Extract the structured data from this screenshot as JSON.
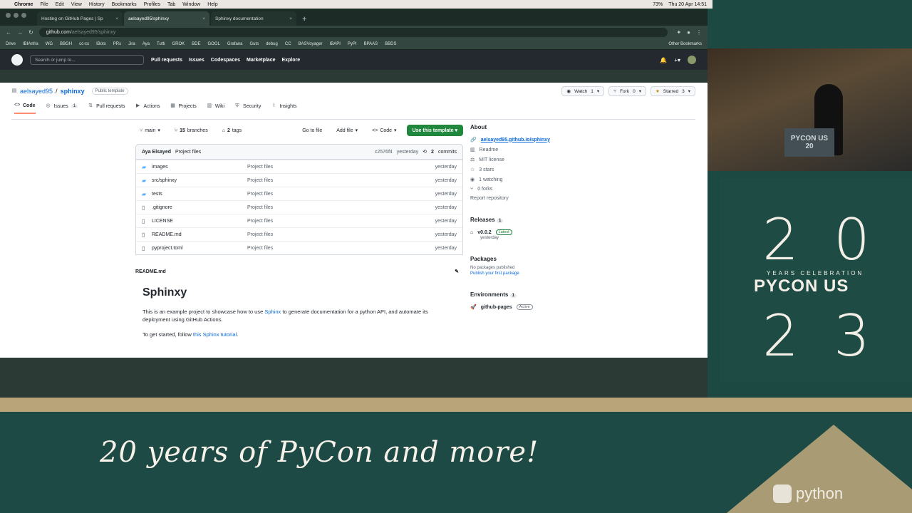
{
  "mac": {
    "app": "Chrome",
    "menus": [
      "File",
      "Edit",
      "View",
      "History",
      "Bookmarks",
      "Profiles",
      "Tab",
      "Window",
      "Help"
    ],
    "battery": "73%",
    "datetime": "Thu 20 Apr  14:51"
  },
  "browser": {
    "tabs": [
      {
        "title": "Hosting on GitHub Pages | Sp"
      },
      {
        "title": "aelsayed95/sphinxy"
      },
      {
        "title": "Sphinxy documentation"
      }
    ],
    "url": "github.com",
    "url_rest": "/aelsayed95/sphinxy",
    "bookmarks": [
      "Drive",
      "IBIAnfra",
      "WG",
      "BBGH",
      "cc-cs",
      "IBots",
      "PRs",
      "Jira",
      "Aya",
      "Tutti",
      "GROK",
      "BDE",
      "GOOL",
      "Grafana",
      "Guts",
      "debug",
      "CC",
      "BASVoyager",
      "IBAPI",
      "PyPI",
      "BPAAS",
      "BBDS"
    ],
    "other_bookmarks": "Other Bookmarks"
  },
  "github": {
    "search_placeholder": "Search or jump to...",
    "nav": [
      "Pull requests",
      "Issues",
      "Codespaces",
      "Marketplace",
      "Explore"
    ],
    "owner": "aelsayed95",
    "repo": "sphinxy",
    "visibility": "Public template",
    "watch": {
      "label": "Watch",
      "count": "1"
    },
    "fork": {
      "label": "Fork",
      "count": "0"
    },
    "star": {
      "label": "Starred",
      "count": "3"
    },
    "tabs": [
      {
        "label": "Code"
      },
      {
        "label": "Issues",
        "count": "1"
      },
      {
        "label": "Pull requests"
      },
      {
        "label": "Actions"
      },
      {
        "label": "Projects"
      },
      {
        "label": "Wiki"
      },
      {
        "label": "Security"
      },
      {
        "label": "Insights"
      }
    ],
    "branch": "main",
    "branches": "15",
    "branches_label": "branches",
    "tags": "2",
    "tags_label": "tags",
    "goto_file": "Go to file",
    "add_file": "Add file",
    "code_btn": "Code",
    "use_template": "Use this template",
    "commit": {
      "author": "Aya Elsayed",
      "message": "Project files",
      "hash": "c2576f4",
      "when": "yesterday",
      "commits": "2",
      "commits_label": "commits"
    },
    "files": [
      {
        "type": "dir",
        "name": "images",
        "msg": "Project files",
        "date": "yesterday"
      },
      {
        "type": "dir",
        "name": "src/sphinxy",
        "msg": "Project files",
        "date": "yesterday"
      },
      {
        "type": "dir",
        "name": "tests",
        "msg": "Project files",
        "date": "yesterday"
      },
      {
        "type": "file",
        "name": ".gitignore",
        "msg": "Project files",
        "date": "yesterday"
      },
      {
        "type": "file",
        "name": "LICENSE",
        "msg": "Project files",
        "date": "yesterday"
      },
      {
        "type": "file",
        "name": "README.md",
        "msg": "Project files",
        "date": "yesterday"
      },
      {
        "type": "file",
        "name": "pyproject.toml",
        "msg": "Project files",
        "date": "yesterday"
      }
    ],
    "readme": {
      "file": "README.md",
      "title": "Sphinxy",
      "p1_a": "This is an example project to showcase how to use",
      "p1_link": "Sphinx",
      "p1_b": "to generate documentation for a python API, and automate its deployment using GitHub Actions.",
      "p2_a": "To get started, follow",
      "p2_link": "this Sphinx tutorial",
      "p2_b": "."
    },
    "about": {
      "title": "About",
      "link": "aelsayed95.github.io/sphinxy",
      "readme": "Readme",
      "license": "MIT license",
      "stars": "3 stars",
      "watching": "1 watching",
      "forks": "0 forks",
      "report": "Report repository"
    },
    "releases": {
      "title": "Releases",
      "count": "1",
      "version": "v0.0.2",
      "badge": "Latest",
      "when": "yesterday"
    },
    "packages": {
      "title": "Packages",
      "none": "No packages published",
      "publish": "Publish your first package"
    },
    "environments": {
      "title": "Environments",
      "count": "1",
      "name": "github-pages",
      "status": "Active"
    }
  },
  "pycon": {
    "n1": "2",
    "n2": "0",
    "n3": "2",
    "n4": "3",
    "sub": "YEARS CELEBRATION",
    "title": "PYCON US",
    "tagline": "20 years of PyCon and more!",
    "python": "python",
    "sign_line1": "PYCON US",
    "sign_line2": "20"
  },
  "colors": {
    "accent": "#1f883d",
    "link": "#0969da",
    "banner": "#1d4a44",
    "tan": "#b9a47a"
  }
}
